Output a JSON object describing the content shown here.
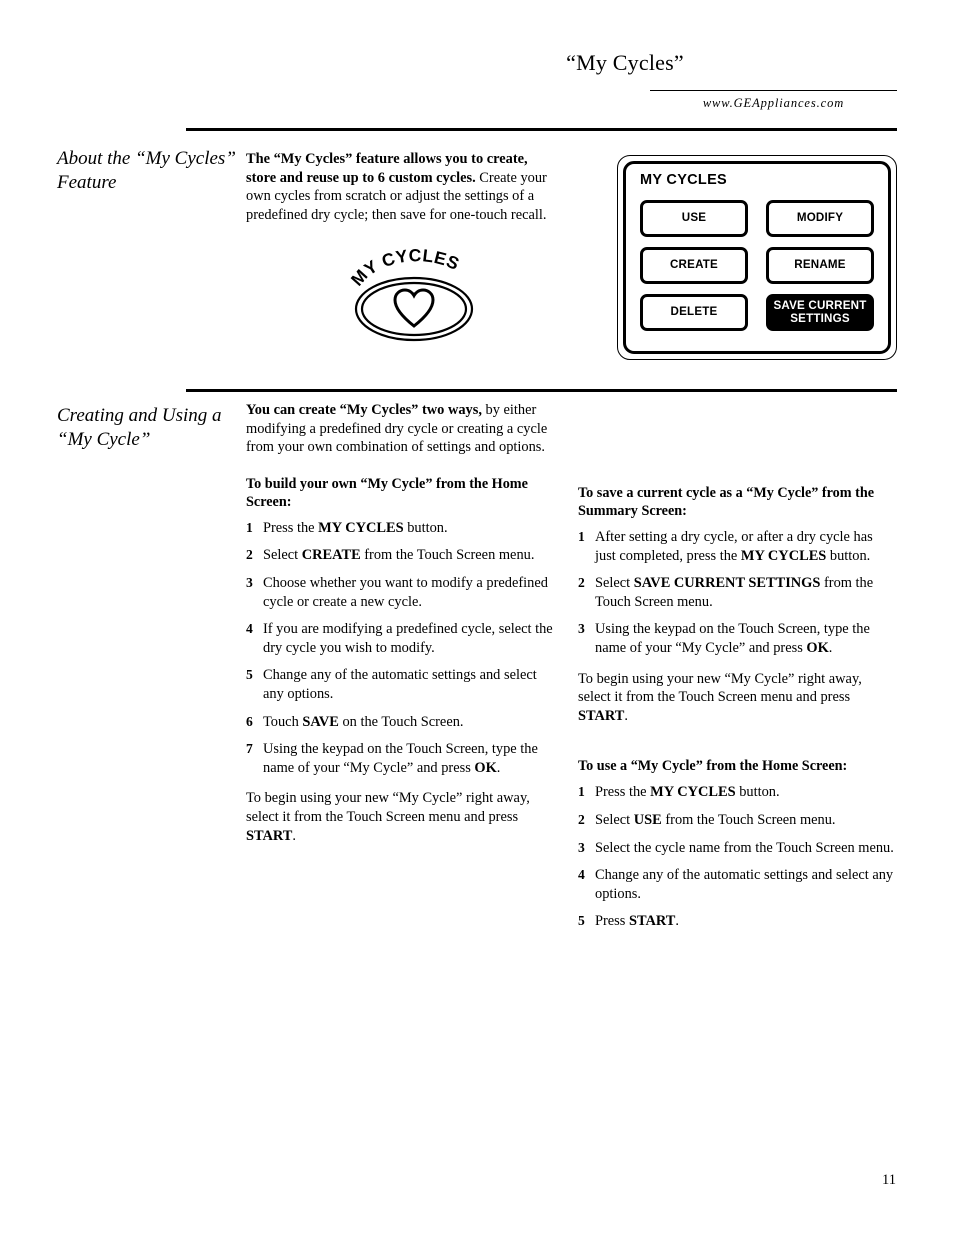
{
  "header": {
    "title": "“My Cycles”",
    "url": "www.GEAppliances.com"
  },
  "sections": {
    "about": {
      "sidebar_heading": "About the “My Cycles” Feature",
      "intro_bold": "The “My Cycles” feature allows you to create, store and reuse up to 6 custom cycles.",
      "intro_rest": " Create your own cycles from scratch or adjust the settings of a predefined dry cycle; then save for one-touch recall."
    },
    "creating": {
      "sidebar_heading": "Creating and Using a “My Cycle”",
      "intro_bold": "You can create “My Cycles” two ways,",
      "intro_rest": " by either modifying a predefined dry cycle or creating a cycle from your own combination of settings and options."
    }
  },
  "cycles_button": {
    "label": "MY CYCLES",
    "icon": "heart-icon"
  },
  "touch_panel": {
    "title": "MY CYCLES",
    "buttons": [
      {
        "label": "USE",
        "inverted": false
      },
      {
        "label": "MODIFY",
        "inverted": false
      },
      {
        "label": "CREATE",
        "inverted": false
      },
      {
        "label": "RENAME",
        "inverted": false
      },
      {
        "label": "DELETE",
        "inverted": false
      },
      {
        "label": "SAVE CURRENT SETTINGS",
        "inverted": true
      }
    ]
  },
  "procedures": {
    "build_own": {
      "heading": "To build your own “My Cycle” from the Home Screen:",
      "steps": [
        {
          "num": "1",
          "pre": "Press the ",
          "bold": "MY CYCLES",
          "post": " button."
        },
        {
          "num": "2",
          "pre": "Select ",
          "bold": "CREATE",
          "post": " from the Touch Screen menu."
        },
        {
          "num": "3",
          "pre": "Choose whether you want to modify a predefined cycle or create a new cycle.",
          "bold": "",
          "post": ""
        },
        {
          "num": "4",
          "pre": "If you are modifying a predefined cycle, select the dry cycle you wish to modify.",
          "bold": "",
          "post": ""
        },
        {
          "num": "5",
          "pre": "Change any of the automatic settings and select any options.",
          "bold": "",
          "post": ""
        },
        {
          "num": "6",
          "pre": "Touch ",
          "bold": "SAVE",
          "post": " on the Touch Screen."
        },
        {
          "num": "7",
          "pre": "Using the keypad on the Touch Screen, type the name of your “My Cycle” and press ",
          "bold": "OK",
          "post": "."
        }
      ],
      "closing_pre": "To begin using your new “My Cycle” right away, select it from the Touch Screen menu and press ",
      "closing_bold": "START",
      "closing_post": "."
    },
    "save_current": {
      "heading": "To save a current cycle as a “My Cycle” from the Summary Screen:",
      "steps": [
        {
          "num": "1",
          "pre": "After setting a dry cycle, or after a dry cycle has just completed, press the ",
          "bold": "MY CYCLES",
          "post": " button."
        },
        {
          "num": "2",
          "pre": "Select ",
          "bold": "SAVE CURRENT SETTINGS",
          "post": " from the Touch Screen menu."
        },
        {
          "num": "3",
          "pre": "Using the keypad on the Touch Screen, type the name of your “My Cycle” and press ",
          "bold": "OK",
          "post": "."
        }
      ],
      "closing_pre": "To begin using your new “My Cycle” right away, select it from the Touch Screen menu and press ",
      "closing_bold": "START",
      "closing_post": "."
    },
    "use_cycle": {
      "heading": "To use a “My Cycle” from the Home Screen:",
      "steps": [
        {
          "num": "1",
          "pre": "Press the ",
          "bold": "MY CYCLES",
          "post": " button."
        },
        {
          "num": "2",
          "pre": "Select ",
          "bold": "USE",
          "post": " from the Touch Screen menu."
        },
        {
          "num": "3",
          "pre": "Select the cycle name from the Touch Screen menu.",
          "bold": "",
          "post": ""
        },
        {
          "num": "4",
          "pre": "Change any of the automatic settings and select any options.",
          "bold": "",
          "post": ""
        },
        {
          "num": "5",
          "pre": "Press ",
          "bold": "START",
          "post": "."
        }
      ]
    }
  },
  "footer": {
    "page_number": "11"
  }
}
